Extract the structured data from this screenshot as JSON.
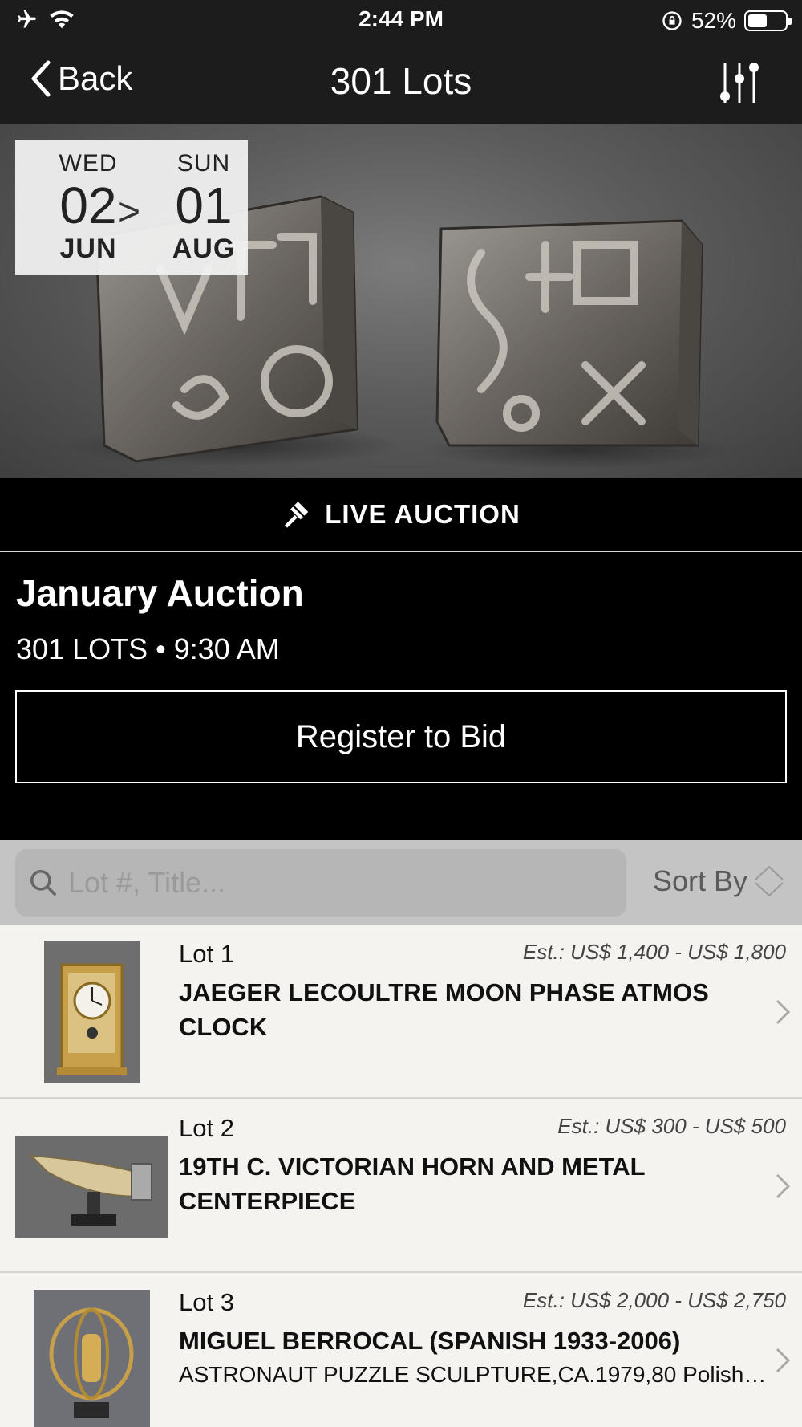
{
  "status_bar": {
    "time": "2:44 PM",
    "battery_text": "52%",
    "battery_level": 0.52
  },
  "nav": {
    "back_label": "Back",
    "title": "301 Lots"
  },
  "hero": {
    "start": {
      "dow": "WED",
      "day": "02",
      "month": "JUN"
    },
    "arrow": ">",
    "end": {
      "dow": "SUN",
      "day": "01",
      "month": "AUG"
    }
  },
  "live_label": "LIVE AUCTION",
  "auction": {
    "title": "January Auction",
    "meta": "301 LOTS • 9:30 AM",
    "register_label": "Register to Bid"
  },
  "search": {
    "placeholder": "Lot #, Title...",
    "sort_label": "Sort By"
  },
  "lots": [
    {
      "number": "Lot 1",
      "estimate": "Est.: US$ 1,400 - US$ 1,800",
      "title": "JAEGER LECOULTRE MOON PHASE ATMOS CLOCK",
      "subtitle": ""
    },
    {
      "number": "Lot 2",
      "estimate": "Est.: US$ 300 - US$ 500",
      "title": "19TH C. VICTORIAN HORN AND METAL CENTERPIECE",
      "subtitle": ""
    },
    {
      "number": "Lot 3",
      "estimate": "Est.: US$ 2,000 - US$ 2,750",
      "title": "MIGUEL BERROCAL (SPANISH 1933-2006)",
      "subtitle": "ASTRONAUT PUZZLE SCULPTURE,CA.1979,80 Polished bronze…"
    }
  ],
  "colors": {
    "bar_bg": "#1c1c1c",
    "band_bg": "#000000",
    "list_bg": "#f4f3f0",
    "search_bg": "#c4c4c4"
  },
  "icons": [
    "airplane-icon",
    "wifi-icon",
    "rotation-lock-icon",
    "battery-icon",
    "back-chevron-icon",
    "filter-sliders-icon",
    "gavel-icon",
    "search-icon",
    "sort-icon",
    "chevron-right-icon"
  ]
}
